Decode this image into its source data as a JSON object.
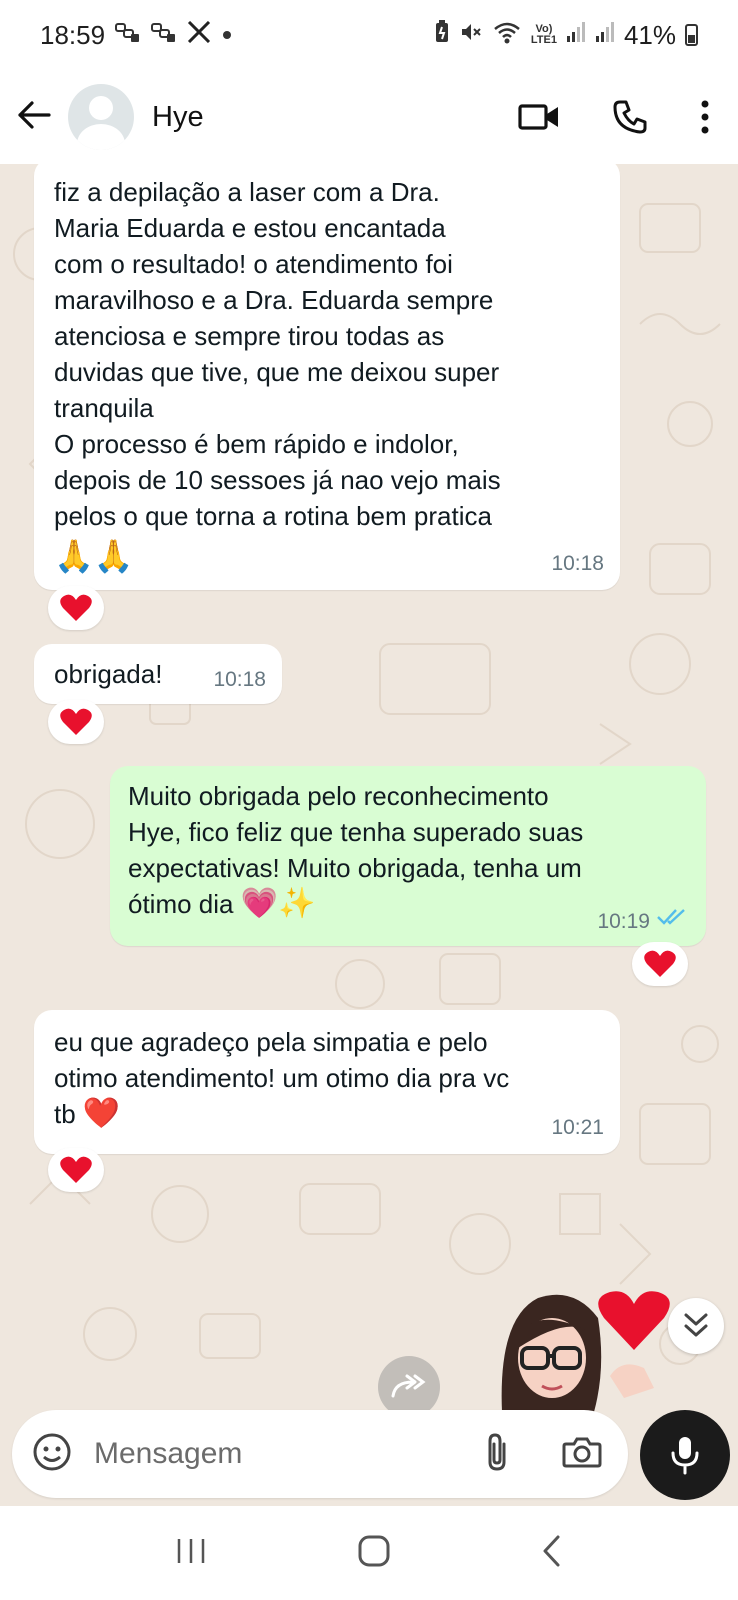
{
  "status_bar": {
    "time": "18:59",
    "battery": "41%",
    "left_icons": [
      "link-icon",
      "link-icon",
      "x-logo-icon",
      "dot-icon"
    ],
    "right_icons": [
      "battery-saver-icon",
      "mute-icon",
      "wifi-icon",
      "volte-icon",
      "signal-icon",
      "signal-icon",
      "battery-icon"
    ],
    "volte_label": "Vo)",
    "lte_label": "LTE1"
  },
  "header": {
    "contact_name": "Hye",
    "back_icon": "arrow-left-icon",
    "video_icon": "video-camera-icon",
    "call_icon": "phone-icon",
    "menu_icon": "kebab-menu-icon"
  },
  "messages": [
    {
      "direction": "in",
      "text": "fiz a depilação a laser com a Dra.\nMaria Eduarda e estou encantada\ncom o resultado! o atendimento foi\nmaravilhoso e a Dra. Eduarda sempre\natenciosa e sempre tirou todas as\nduvidas que tive, que me deixou super\ntranquila\nO processo é bem rápido e indolor,\ndepois de 10 sessoes já nao vejo mais\npelos o que torna a rotina bem pratica",
      "emojis": "🙏🙏",
      "time": "10:18",
      "reaction": "red-heart"
    },
    {
      "direction": "in",
      "text": "obrigada!",
      "time": "10:18",
      "reaction": "red-heart"
    },
    {
      "direction": "out",
      "text": "Muito obrigada pelo reconhecimento\nHye, fico feliz que tenha superado suas\nexpectativas! Muito obrigada, tenha um\nótimo dia",
      "emojis": "💗✨",
      "time": "10:19",
      "status": "read",
      "reaction": "red-heart"
    },
    {
      "direction": "in",
      "text": "eu que agradeço pela simpatia e pelo\notimo atendimento! um otimo dia pra vc\ntb",
      "emojis": "❤️",
      "time": "10:21",
      "reaction": "red-heart"
    }
  ],
  "composer": {
    "placeholder": "Mensagem",
    "emoji_icon": "sticker-smiley-icon",
    "attach_icon": "paperclip-icon",
    "camera_icon": "camera-icon",
    "mic_icon": "microphone-icon"
  },
  "floating": {
    "scroll_down_icon": "double-chevron-down-icon",
    "forward_icon": "forward-arrow-icon",
    "sticker": "avatar-heart-sticker"
  },
  "navbar": {
    "icons": [
      "recent-apps-icon",
      "home-icon",
      "back-chevron-icon"
    ]
  },
  "colors": {
    "chat_background": "#efe7de",
    "outgoing_bubble": "#d9fdd3",
    "incoming_bubble": "#ffffff",
    "read_ticks": "#53bdeb",
    "heart": "#e8112d"
  }
}
